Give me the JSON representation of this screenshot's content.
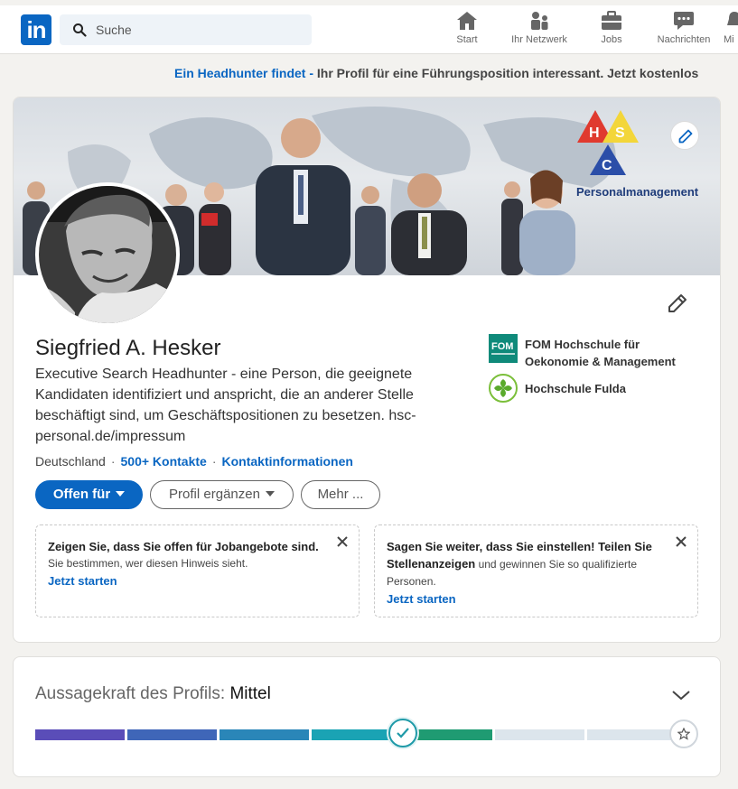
{
  "nav": {
    "logo_text": "in",
    "search_placeholder": "Suche",
    "items": [
      {
        "label": "Start",
        "icon": "home-icon"
      },
      {
        "label": "Ihr Netzwerk",
        "icon": "network-icon"
      },
      {
        "label": "Jobs",
        "icon": "briefcase-icon"
      },
      {
        "label": "Nachrichten",
        "icon": "messaging-icon"
      },
      {
        "label": "Mi",
        "icon": "notifications-icon"
      }
    ]
  },
  "promo": {
    "link_text": "Ein Headhunter findet -",
    "rest_text": " Ihr Profil für eine Führungsposition interessant. Jetzt kostenlos"
  },
  "banner": {
    "logo_letters": [
      "H",
      "S",
      "C"
    ],
    "logo_caption": "Personalmanagement"
  },
  "profile": {
    "name": "Siegfried A. Hesker",
    "headline": "Executive Search Headhunter - eine Person, die geeignete Kandidaten identifiziert und anspricht, die an anderer Stelle beschäftigt sind, um Geschäftspositionen zu besetzen. hsc-personal.de/impressum",
    "location": "Deutschland",
    "connections": "500+ Kontakte",
    "contact_info": "Kontaktinformationen",
    "education": [
      {
        "name": "FOM Hochschule für Oekonomie & Management",
        "logo_text": "FOM"
      },
      {
        "name": "Hochschule Fulda"
      }
    ]
  },
  "actions": {
    "primary": "Offen für",
    "add_section": "Profil ergänzen",
    "more": "Mehr ..."
  },
  "tips": [
    {
      "title": "Zeigen Sie, dass Sie offen für Jobangebote sind.",
      "body": "Sie bestimmen, wer diesen Hinweis sieht.",
      "cta": "Jetzt starten"
    },
    {
      "title": "Sagen Sie weiter, dass Sie einstellen! Teilen Sie",
      "title_bold": "Stellenanzeigen",
      "body": " und gewinnen Sie so qualifizierte Personen.",
      "cta": "Jetzt starten"
    }
  ],
  "strength": {
    "label": "Aussagekraft des Profils: ",
    "value": "Mittel",
    "steps_total": 7,
    "steps_completed": 5,
    "segment_colors": [
      "#5a4db8",
      "#3f66b8",
      "#2a86b8",
      "#1aa3b4",
      "#1f9b72",
      "#dce5ec",
      "#dce5ec"
    ]
  }
}
